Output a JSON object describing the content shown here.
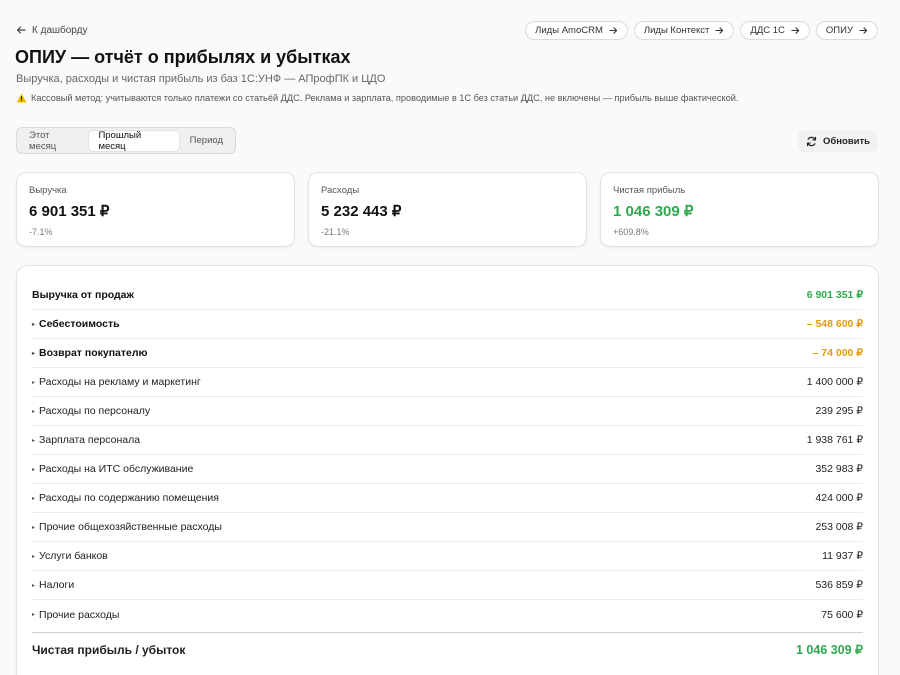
{
  "nav": {
    "back_label": "К дашборду",
    "links": [
      "Лиды AmoCRM",
      "Лиды Контекст",
      "ДДС 1С",
      "ОПИУ"
    ]
  },
  "header": {
    "title": "ОПИУ — отчёт о прибылях и убытках",
    "subtitle": "Выручка, расходы и чистая прибыль из баз 1С:УНФ — АПрофПК и ЦДО",
    "warning": "Кассовый метод: учитываются только платежи со статьёй ДДС. Реклама и зарплата, проводимые в 1С без статьи ДДС, не включены — прибыль выше фактической."
  },
  "periods": {
    "tabs": [
      "Этот месяц",
      "Прошлый месяц",
      "Период"
    ],
    "active": "Прошлый месяц"
  },
  "refresh_label": "Обновить",
  "cards": [
    {
      "label": "Выручка",
      "value": "6 901 351 ₽",
      "change": "-7.1%"
    },
    {
      "label": "Расходы",
      "value": "5 232 443 ₽",
      "change": "-21.1%"
    },
    {
      "label": "Чистая прибыль",
      "value": "1 046 309 ₽",
      "change": "+609.8%"
    }
  ],
  "rows": [
    {
      "name": "Выручка от продаж",
      "amount": "6 901 351 ₽"
    },
    {
      "name": "Себестоимость",
      "amount": "– 548 600 ₽"
    },
    {
      "name": "Возврат покупателю",
      "amount": "– 74 000 ₽"
    },
    {
      "name": "Расходы на рекламу и маркетинг",
      "amount": "1 400 000 ₽"
    },
    {
      "name": "Расходы по персоналу",
      "amount": "239 295 ₽"
    },
    {
      "name": "Зарплата персонала",
      "amount": "1 938 761 ₽"
    },
    {
      "name": "Расходы на ИТС обслуживание",
      "amount": "352 983 ₽"
    },
    {
      "name": "Расходы по содержанию помещения",
      "amount": "424 000 ₽"
    },
    {
      "name": "Прочие общехозяйственные расходы",
      "amount": "253 008 ₽"
    },
    {
      "name": "Услуги банков",
      "amount": "11 937 ₽"
    },
    {
      "name": "Налоги",
      "amount": "536 859 ₽"
    },
    {
      "name": "Прочие расходы",
      "amount": "75 600 ₽"
    }
  ],
  "total": {
    "name": "Чистая прибыль / убыток",
    "amount": "1 046 309 ₽"
  },
  "colors": {
    "positive": "#2fa84f",
    "deduction": "#e39a17"
  }
}
